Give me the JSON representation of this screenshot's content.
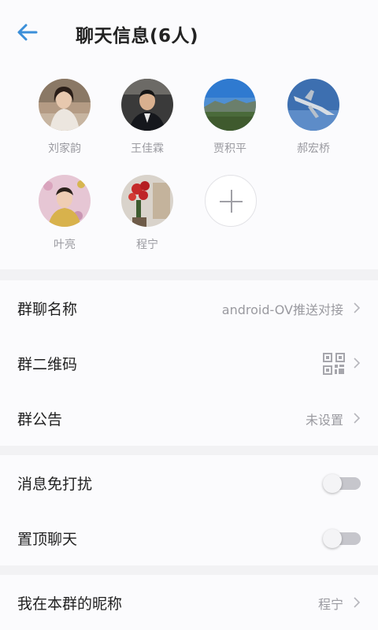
{
  "header": {
    "title": "聊天信息(6人)",
    "back_icon": "arrow-left-icon",
    "accent": "#3b8fd9"
  },
  "members": [
    {
      "name": "刘家韵"
    },
    {
      "name": "王佳霖"
    },
    {
      "name": "贾积平"
    },
    {
      "name": "郝宏桥"
    },
    {
      "name": "叶亮"
    },
    {
      "name": "程宁"
    }
  ],
  "add_member_icon": "plus-icon",
  "settings": {
    "group_name": {
      "label": "群聊名称",
      "value": "android-OV推送对接"
    },
    "qr_code": {
      "label": "群二维码",
      "icon": "qr-code-icon"
    },
    "announcement": {
      "label": "群公告",
      "value": "未设置"
    },
    "mute": {
      "label": "消息免打扰",
      "on": false
    },
    "pin": {
      "label": "置顶聊天",
      "on": false
    },
    "nickname": {
      "label": "我在本群的昵称",
      "value": "程宁"
    }
  }
}
